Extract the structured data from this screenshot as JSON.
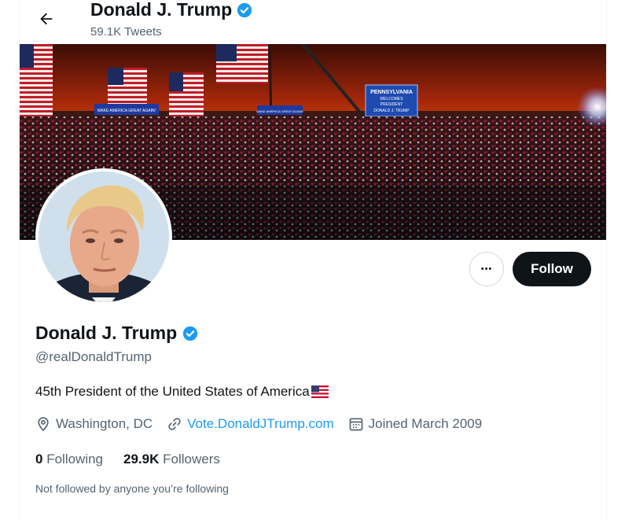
{
  "header": {
    "name": "Donald J. Trump",
    "tweet_count": "59.1K Tweets"
  },
  "banner": {
    "signs": [
      "PENNSYLVANIA",
      "WELCOMES",
      "PRESIDENT",
      "DONALD J. TRUMP",
      "MAKE AMERICA GREAT AGAIN!",
      "MAKE AMERICA GREAT AGAIN!"
    ]
  },
  "actions": {
    "more_label": "•••",
    "follow_label": "Follow"
  },
  "profile": {
    "name": "Donald J. Trump",
    "handle": "@realDonaldTrump",
    "bio": "45th President of the United States of America",
    "location": "Washington, DC",
    "website": "Vote.DonaldJTrump.com",
    "joined": "Joined March 2009",
    "following_count": "0",
    "following_label": "Following",
    "followers_count": "29.9K",
    "followers_label": "Followers",
    "followed_by_note": "Not followed by anyone you’re following"
  },
  "icons": [
    "back-arrow-icon",
    "verified-badge-icon",
    "location-pin-icon",
    "link-icon",
    "calendar-icon",
    "us-flag-icon"
  ],
  "colors": {
    "accent": "#1d9bf0",
    "text": "#0f1419",
    "muted": "#536471",
    "button": "#0f1419"
  }
}
